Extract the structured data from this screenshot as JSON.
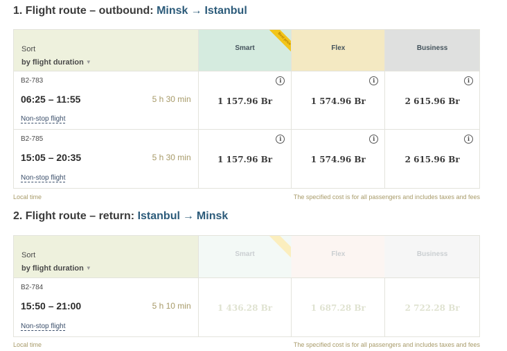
{
  "outbound": {
    "heading_prefix": "1. Flight route – outbound:",
    "from": "Minsk",
    "arrow": "→",
    "to": "Istanbul",
    "sort_label": "Sort",
    "sort_value": "by flight duration",
    "fares": {
      "smart": "Smart",
      "flex": "Flex",
      "business": "Business"
    },
    "ribbon_text": "Best price",
    "flights": [
      {
        "number": "B2-783",
        "time": "06:25 – 11:55",
        "duration": "5 h 30 min",
        "stops": "Non-stop flight",
        "price_smart": "1 157.96 Br",
        "price_flex": "1 574.96 Br",
        "price_business": "2 615.96 Br"
      },
      {
        "number": "B2-785",
        "time": "15:05 – 20:35",
        "duration": "5 h 30 min",
        "stops": "Non-stop flight",
        "price_smart": "1 157.96 Br",
        "price_flex": "1 574.96 Br",
        "price_business": "2 615.96 Br"
      }
    ],
    "local_time": "Local time",
    "cost_note": "The specified cost is for all passengers and includes taxes and fees"
  },
  "return": {
    "heading_prefix": "2. Flight route – return:",
    "from": "Istanbul",
    "arrow": "→",
    "to": "Minsk",
    "sort_label": "Sort",
    "sort_value": "by flight duration",
    "fares": {
      "smart": "Smart",
      "flex": "Flex",
      "business": "Business"
    },
    "flights": [
      {
        "number": "B2-784",
        "time": "15:50 – 21:00",
        "duration": "5 h 10 min",
        "stops": "Non-stop flight",
        "price_smart": "1 436.28 Br",
        "price_flex": "1 687.28 Br",
        "price_business": "2 722.28 Br"
      }
    ],
    "local_time": "Local time",
    "cost_note": "The specified cost is for all passengers and includes taxes and fees"
  },
  "icons": {
    "info": "i",
    "chevron": "▼"
  },
  "colors": {
    "city": "#2c5b7a",
    "smart": "#d5ebdf",
    "flex": "#f4e9c2",
    "business": "#dfe0df",
    "sort_header": "#eef1dd",
    "ribbon": "#f3c519",
    "duration": "#a79a68"
  }
}
